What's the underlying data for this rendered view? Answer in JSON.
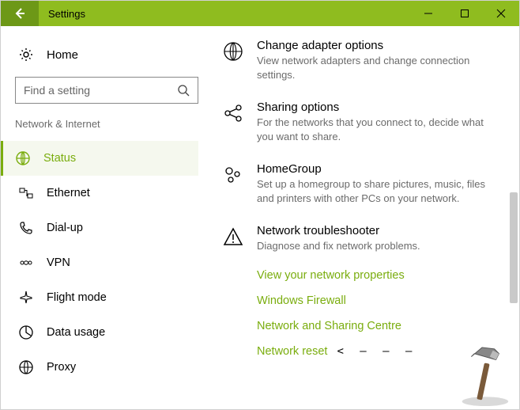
{
  "window": {
    "title": "Settings"
  },
  "sidebar": {
    "home": "Home",
    "search_placeholder": "Find a setting",
    "section": "Network & Internet",
    "items": [
      {
        "label": "Status"
      },
      {
        "label": "Ethernet"
      },
      {
        "label": "Dial-up"
      },
      {
        "label": "VPN"
      },
      {
        "label": "Flight mode"
      },
      {
        "label": "Data usage"
      },
      {
        "label": "Proxy"
      }
    ]
  },
  "main": {
    "options": [
      {
        "title": "Change adapter options",
        "desc": "View network adapters and change connection settings."
      },
      {
        "title": "Sharing options",
        "desc": "For the networks that you connect to, decide what you want to share."
      },
      {
        "title": "HomeGroup",
        "desc": "Set up a homegroup to share pictures, music, files and printers with other PCs on your network."
      },
      {
        "title": "Network troubleshooter",
        "desc": "Diagnose and fix network problems."
      }
    ],
    "links": [
      "View your network properties",
      "Windows Firewall",
      "Network and Sharing Centre",
      "Network reset"
    ]
  },
  "colors": {
    "accent": "#7aad0e",
    "titlebar": "#8fbc1f"
  }
}
